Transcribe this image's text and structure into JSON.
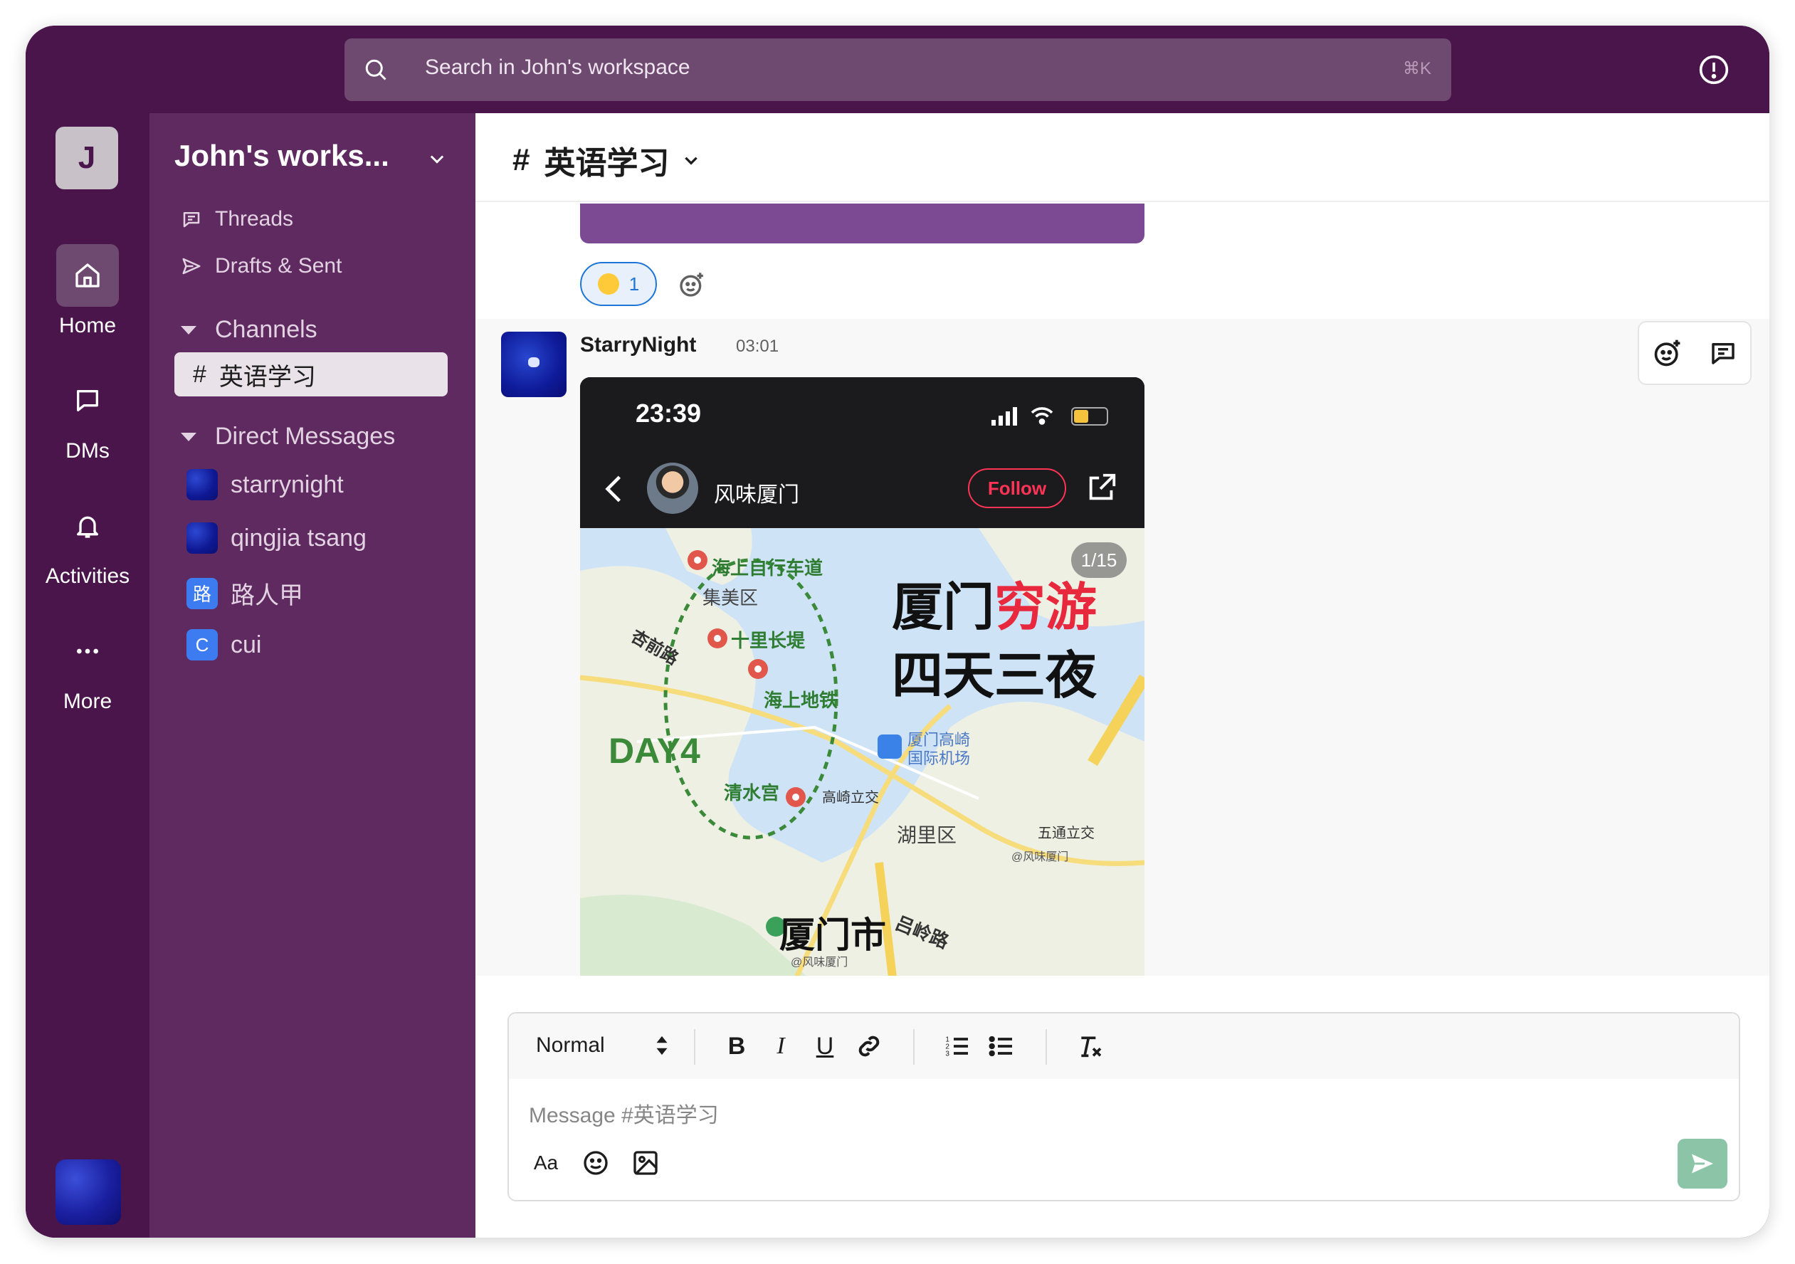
{
  "search": {
    "placeholder": "Search in John's workspace",
    "shortcut": "⌘K"
  },
  "rail": {
    "workspace_initial": "J",
    "items": [
      {
        "label": "Home"
      },
      {
        "label": "DMs"
      },
      {
        "label": "Activities"
      },
      {
        "label": "More"
      }
    ]
  },
  "sidebar": {
    "workspace_name": "John's works...",
    "nav": [
      {
        "label": "Threads"
      },
      {
        "label": "Drafts & Sent"
      }
    ],
    "channels_header": "Channels",
    "channels": [
      {
        "hash": "#",
        "name": "英语学习"
      }
    ],
    "dms_header": "Direct Messages",
    "dms": [
      {
        "name": "starrynight"
      },
      {
        "name": "qingjia tsang"
      },
      {
        "name": "路人甲",
        "initial": "路"
      },
      {
        "name": "cui",
        "initial": "C"
      }
    ]
  },
  "channel": {
    "hash": "#",
    "title": "英语学习"
  },
  "reaction": {
    "count": "1"
  },
  "message": {
    "author": "StarryNight",
    "time": "03:01",
    "phone": {
      "time": "23:39",
      "account": "风味厦门",
      "follow": "Follow",
      "pager": "1/15",
      "map": {
        "title_black": "厦门",
        "title_red": "穷游",
        "subtitle": "四天三夜",
        "day": "DAY4",
        "labels": [
          "海上自行车道",
          "集美区",
          "杏前路",
          "十里长堤",
          "海上地铁",
          "清水宫",
          "厦门高崎",
          "国际机场",
          "高崎立交",
          "湖里区",
          "五通立交",
          "@风味厦门",
          "厦门市",
          "吕岭路",
          "@风味厦门"
        ]
      }
    }
  },
  "composer": {
    "format": "Normal",
    "placeholder": "Message #英语学习",
    "text_style_icon": "Aa",
    "bold": "B",
    "italic": "I",
    "underline": "U"
  },
  "colors": {
    "brand": "#4a154b",
    "sidebar": "#5e2a60",
    "accent": "#1d75d8",
    "send": "#8bc4a6"
  }
}
